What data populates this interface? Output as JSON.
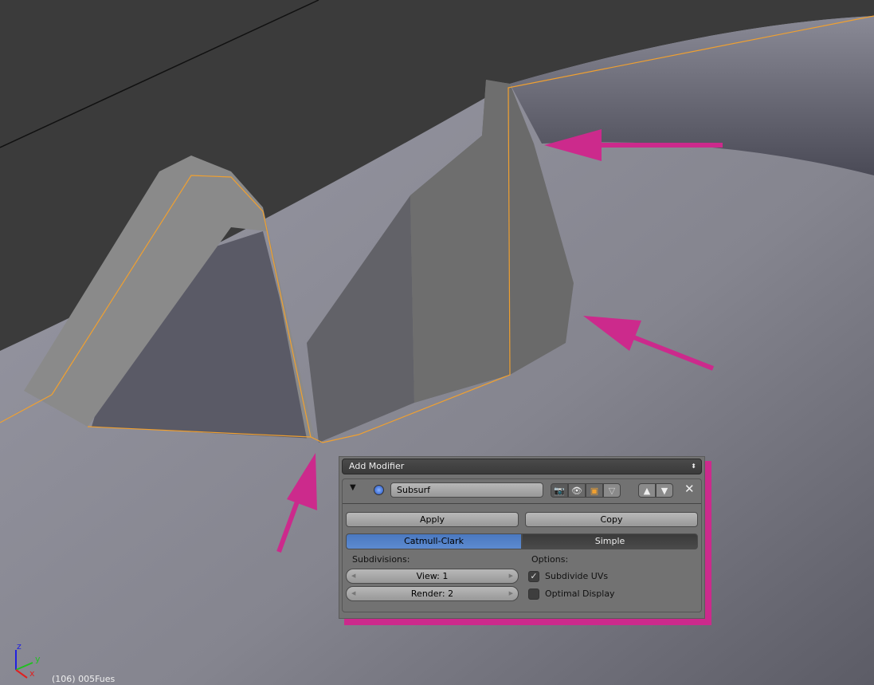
{
  "viewport": {
    "status_text": "(106) 005Fues",
    "axes": {
      "x": "x",
      "y": "y",
      "z": "z"
    },
    "annotation_color": "#cc2a8c",
    "selection_color": "#f0a030"
  },
  "modifier_panel": {
    "add_modifier_label": "Add Modifier",
    "modifier_name": "Subsurf",
    "apply_label": "Apply",
    "copy_label": "Copy",
    "modes": [
      {
        "label": "Catmull-Clark",
        "selected": true
      },
      {
        "label": "Simple",
        "selected": false
      }
    ],
    "subdivisions_label": "Subdivisions:",
    "view_label": "View: 1",
    "render_label": "Render: 2",
    "options_label": "Options:",
    "subdivide_uvs": {
      "label": "Subdivide UVs",
      "checked": true
    },
    "optimal_display": {
      "label": "Optimal Display",
      "checked": false
    },
    "accent_color": "#5680c2"
  }
}
